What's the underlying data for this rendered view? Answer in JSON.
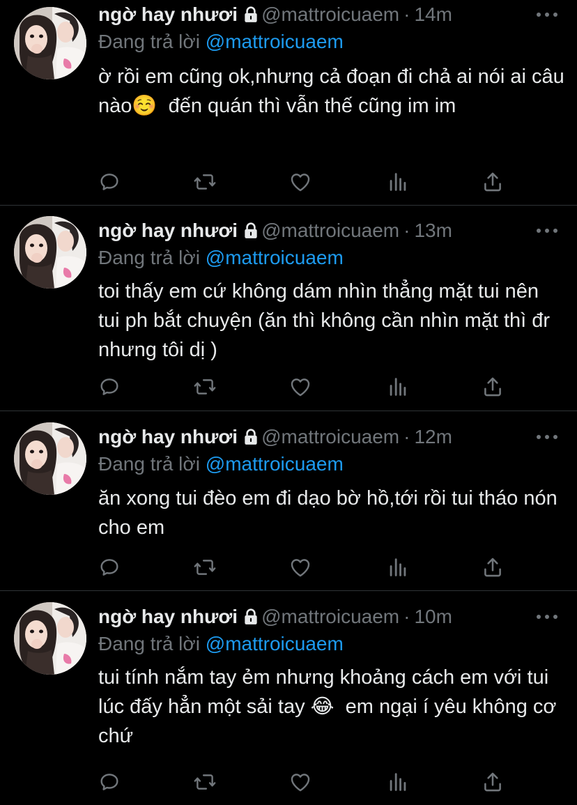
{
  "tweets": [
    {
      "name": "ngờ hay nhươi",
      "handle": "@mattroicuaem",
      "time": "14m",
      "reply_prefix": "Đang trả lời",
      "reply_to": "@mattroicuaem",
      "text": "ờ rồi em cũng ok,nhưng cả đoạn đi chả ai nói ai câu nào☺️  đến quán thì vẫn thế cũng im im"
    },
    {
      "name": "ngờ hay nhươi",
      "handle": "@mattroicuaem",
      "time": "13m",
      "reply_prefix": "Đang trả lời",
      "reply_to": "@mattroicuaem",
      "text": "toi thấy em cứ không dám nhìn thẳng mặt tui nên tui ph bắt chuyện (ăn thì không cần nhìn mặt thì đr nhưng tôi dị )"
    },
    {
      "name": "ngờ hay nhươi",
      "handle": "@mattroicuaem",
      "time": "12m",
      "reply_prefix": "Đang trả lời",
      "reply_to": "@mattroicuaem",
      "text": "ăn xong tui đèo em đi dạo bờ hồ,tới rồi tui tháo nón cho em"
    },
    {
      "name": "ngờ hay nhươi",
      "handle": "@mattroicuaem",
      "time": "10m",
      "reply_prefix": "Đang trả lời",
      "reply_to": "@mattroicuaem",
      "text": "tui tính nắm tay ẻm nhưng khoảng cách em với tui lúc đấy hẳn một sải tay 😂  em ngại í yêu không cơ chứ"
    }
  ],
  "icons": [
    "reply-icon",
    "retweet-icon",
    "like-icon",
    "analytics-icon",
    "share-icon"
  ],
  "colors": {
    "background": "#000000",
    "text": "#e7e9ea",
    "muted": "#71767b",
    "accent": "#1d9bf0",
    "divider": "#2f3336"
  }
}
